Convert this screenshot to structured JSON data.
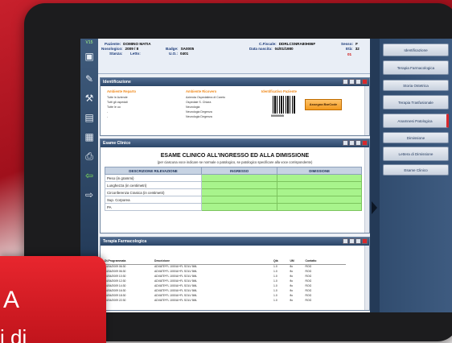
{
  "patient": {
    "version": "V15",
    "labels": {
      "paziente": "Paziente:",
      "nosologico": "Nosologico:",
      "stanza": "Stanza:",
      "letto": "Letto:",
      "badge": "Badge:",
      "uo": "U.O.:",
      "cf": "C.Fiscale:",
      "dob": "Data nascita:",
      "sesso": "Sesso:",
      "eta": "Età:"
    },
    "name": "DOMINO MATIA",
    "nosologico": "2009 / 8",
    "badge": "SA0005",
    "uo": "0401",
    "cf": "DDRLCSNRA80H86F",
    "dob": "04/01/1980",
    "sesso": "F",
    "eta": "32",
    "alert": "01"
  },
  "identificazione": {
    "title": "Identificazione",
    "ambiente_reparto": {
      "heading": "Ambiente Reparto",
      "items": [
        "Tutte le Aziende",
        "Tutti gli ospedali",
        "Tutte le uo",
        "-",
        "-"
      ]
    },
    "ambiente_ricovero": {
      "heading": "Ambiente Ricovero",
      "items": [
        "Azienda Ospedaliera di Careto",
        "Ospedale S. Chiara",
        "Neurologia",
        "Neurologia Degenza",
        "Neurologia Degenza"
      ]
    },
    "identificativo": {
      "heading": "Identificativo Paziente",
      "code": "00000000"
    },
    "assign_label": "Assegna BarCode"
  },
  "esame": {
    "title": "Esame Clinico",
    "heading": "ESAME CLINICO ALL'INGRESSO ED ALLA DIMISSIONE",
    "subheading": "(per ciascuna voce indicare se normale o patologico, se patologico specificare alla voce corrispondente)",
    "columns": [
      "DESCRIZIONE RILEVAZIONE",
      "INGRESSO",
      "DIMISSIONE"
    ],
    "rows": [
      "Peso (in grammi)",
      "Lunghezza (in centimetri)",
      "Circonferenza Cranica (in centimetri)",
      "Sup. Corporea",
      "PA"
    ]
  },
  "terapia": {
    "title": "Terapia Farmacologica",
    "columns": [
      "Dt.Programmata",
      "Descrizione",
      "Qtà",
      "UM",
      "Contatto"
    ],
    "rows": [
      [
        "14/04/2009 06:30",
        "ADVATE*FL 1000UI+FL SOLV 5ML",
        "1.0",
        "flo",
        "ROG"
      ],
      [
        "14/04/2009 06:30",
        "ADVATE*FL 1000UI+FL SOLV 5ML",
        "1.0",
        "flo",
        "ROG"
      ],
      [
        "14/04/2009 10:30",
        "ADVATE*FL 1000UI+FL SOLV 5ML",
        "1.0",
        "flo",
        "ROG"
      ],
      [
        "14/04/2009 12:30",
        "ADVATE*FL 1000UI+FL SOLV 5ML",
        "1.0",
        "flo",
        "ROG"
      ],
      [
        "14/04/2009 14:30",
        "ADVATE*FL 1000UI+FL SOLV 5ML",
        "1.0",
        "flo",
        "ROG"
      ],
      [
        "14/04/2009 16:30",
        "ADVATE*FL 1000UI+FL SOLV 5ML",
        "1.0",
        "flo",
        "ROG"
      ],
      [
        "14/04/2009 18:30",
        "ADVATE*FL 1000UI+FL SOLV 5ML",
        "1.0",
        "flo",
        "ROG"
      ],
      [
        "14/04/2009 22:30",
        "ADVATE*FL 1000UI+FL SOLV 5ML",
        "1.0",
        "flo",
        "ROG"
      ]
    ]
  },
  "menu": {
    "items": [
      "Identificazione",
      "Terapia Farmacologica",
      "Storia Ostetrica",
      "Terapia Trasfusionale",
      "Anamnesi Patologica",
      "Dimissione",
      "Lettera di Dimissione",
      "Esame Clinico"
    ]
  },
  "overlay": {
    "big": "A",
    "small": "i di"
  },
  "colors": {
    "brand_red": "#d8282c",
    "header_blue": "#2b4668",
    "field_green": "#a8f48c",
    "orange": "#f08a1c"
  }
}
